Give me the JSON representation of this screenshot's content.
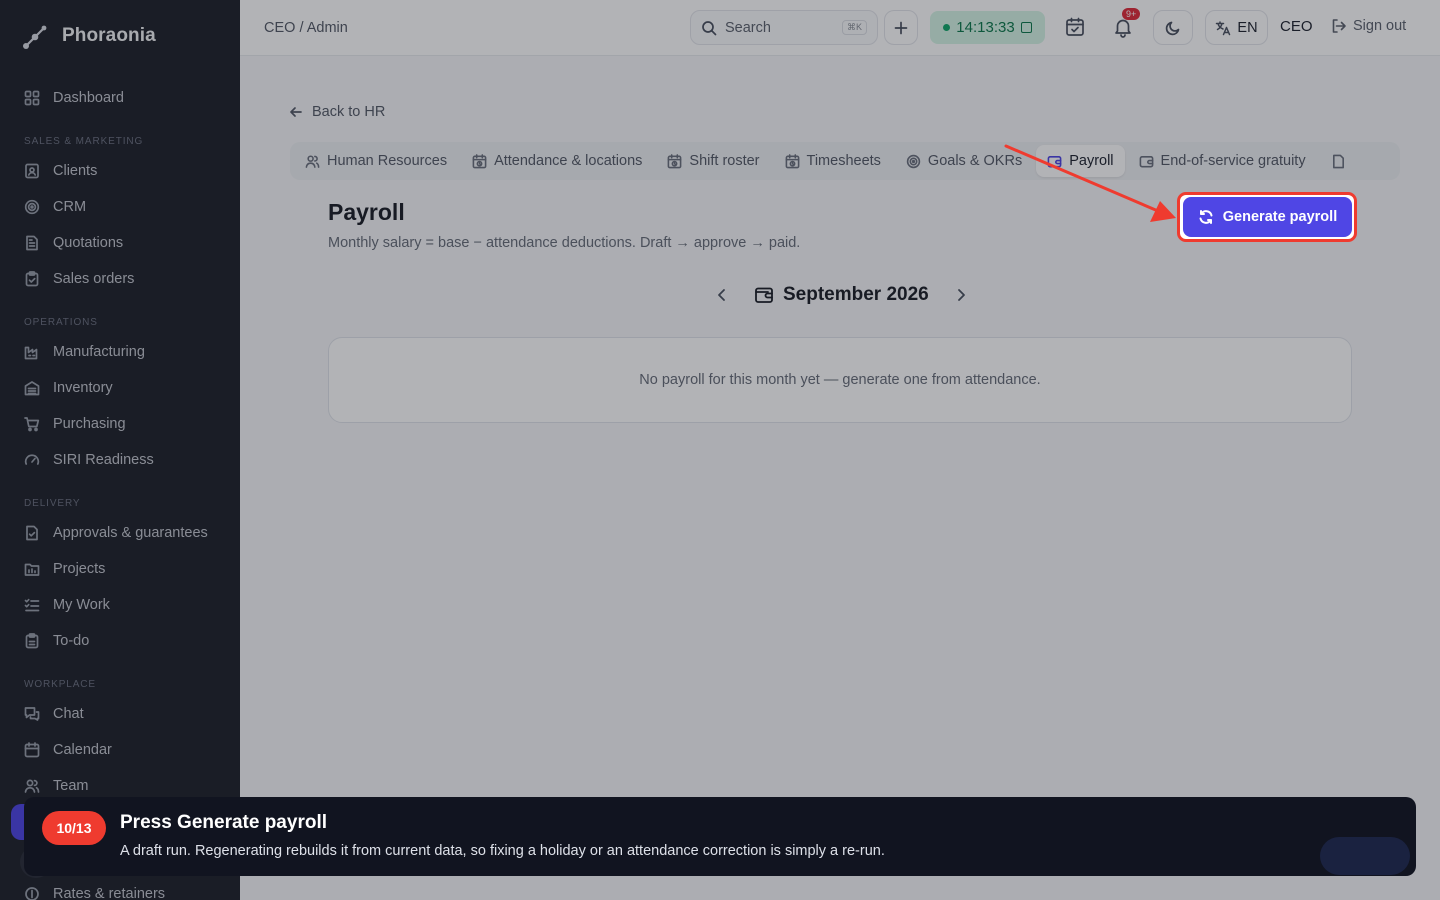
{
  "app": {
    "name": "Phoraonia"
  },
  "sidebar": {
    "top_item": {
      "label": "Dashboard",
      "icon": "dashboard-icon"
    },
    "sections": [
      {
        "title": "SALES & MARKETING",
        "items": [
          {
            "label": "Clients",
            "icon": "clients-icon"
          },
          {
            "label": "CRM",
            "icon": "crm-icon"
          },
          {
            "label": "Quotations",
            "icon": "quotations-icon"
          },
          {
            "label": "Sales orders",
            "icon": "sales-orders-icon"
          }
        ]
      },
      {
        "title": "OPERATIONS",
        "items": [
          {
            "label": "Manufacturing",
            "icon": "factory-icon"
          },
          {
            "label": "Inventory",
            "icon": "inventory-icon"
          },
          {
            "label": "Purchasing",
            "icon": "cart-icon"
          },
          {
            "label": "SIRI Readiness",
            "icon": "gauge-icon"
          }
        ]
      },
      {
        "title": "DELIVERY",
        "items": [
          {
            "label": "Approvals & guarantees",
            "icon": "approvals-icon"
          },
          {
            "label": "Projects",
            "icon": "projects-icon"
          },
          {
            "label": "My Work",
            "icon": "checklist-icon"
          },
          {
            "label": "To-do",
            "icon": "todo-icon"
          }
        ]
      },
      {
        "title": "WORKPLACE",
        "items": [
          {
            "label": "Chat",
            "icon": "chat-icon"
          },
          {
            "label": "Calendar",
            "icon": "calendar-icon"
          },
          {
            "label": "Team",
            "icon": "team-icon"
          }
        ]
      }
    ],
    "bottom_item": {
      "label": "Rates & retainers",
      "icon": "rates-icon"
    }
  },
  "header": {
    "breadcrumb": "CEO / Admin",
    "search": {
      "placeholder": "Search",
      "shortcut": "⌘K"
    },
    "clock": "14:13:33",
    "notifications_badge": "9+",
    "language": "EN",
    "role": "CEO",
    "sign_out": "Sign out"
  },
  "page": {
    "back_link": "Back to HR",
    "tabs": [
      {
        "label": "Human Resources",
        "icon": "people-icon",
        "active": false
      },
      {
        "label": "Attendance & locations",
        "icon": "calendar-clock-icon",
        "active": false
      },
      {
        "label": "Shift roster",
        "icon": "calendar-clock-icon",
        "active": false
      },
      {
        "label": "Timesheets",
        "icon": "calendar-clock-icon",
        "active": false
      },
      {
        "label": "Goals & OKRs",
        "icon": "target-icon",
        "active": false
      },
      {
        "label": "Payroll",
        "icon": "wallet-icon",
        "active": true
      },
      {
        "label": "End-of-service gratuity",
        "icon": "wallet-icon",
        "active": false
      }
    ],
    "title": "Payroll",
    "subtitle": "Monthly salary = base − attendance deductions. Draft → approve → paid.",
    "generate_button": "Generate payroll",
    "month": "September 2026",
    "empty_state": "No payroll for this month yet — generate one from attendance."
  },
  "tour": {
    "step": "10/13",
    "title": "Press Generate payroll",
    "description": "A draft run. Regenerating rebuilds it from current data, so fixing a holiday or an attendance correction is simply a re-run."
  },
  "colors": {
    "accent": "#4f46e5",
    "highlight": "#ef3b2f",
    "sidebar_bg": "#20232b",
    "clock_bg": "#d6f5e6"
  }
}
